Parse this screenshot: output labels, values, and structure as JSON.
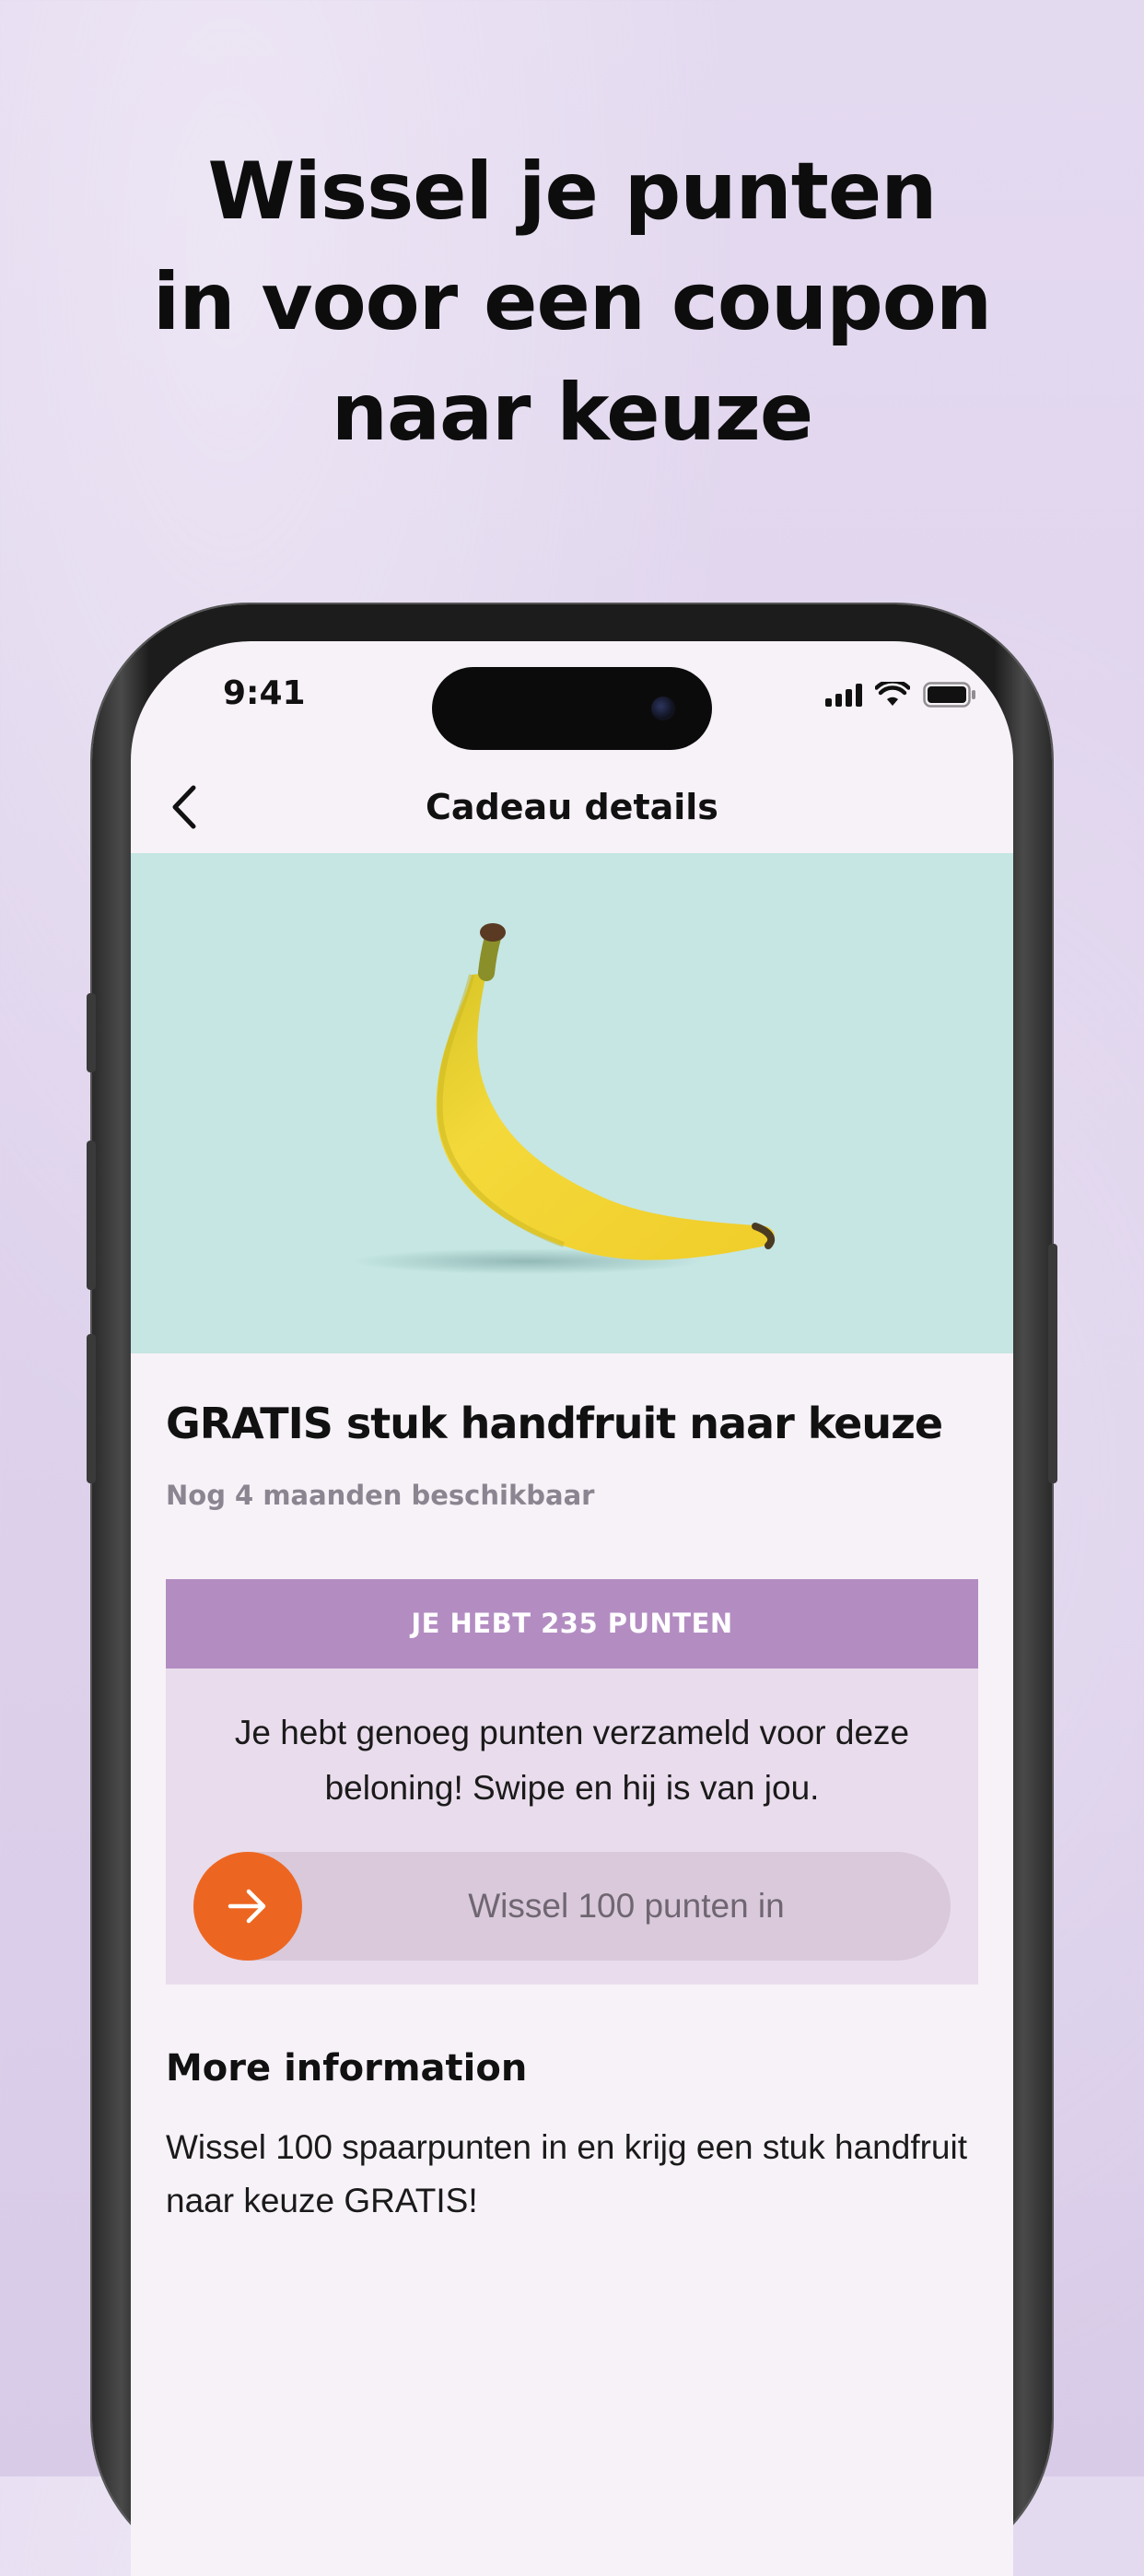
{
  "promo": {
    "headline_line1": "Wissel je punten",
    "headline_line2": "in voor een coupon",
    "headline_line3": "naar keuze"
  },
  "status_bar": {
    "time": "9:41"
  },
  "nav": {
    "title": "Cadeau details",
    "back_icon": "chevron-left-icon"
  },
  "product": {
    "image": "banana",
    "title": "GRATIS stuk handfruit naar keuze",
    "availability": "Nog 4 maanden beschikbaar"
  },
  "points": {
    "header": "JE HEBT 235 PUNTEN",
    "message": "Je hebt genoeg punten verzameld voor deze beloning! Swipe en hij is van jou.",
    "swipe_label": "Wissel 100 punten in",
    "swipe_icon": "arrow-right-icon"
  },
  "more_info": {
    "title": "More information",
    "body": "Wissel 100 spaarpunten in en krijg een stuk handfruit naar keuze GRATIS!"
  },
  "colors": {
    "background": "#e1d6ee",
    "hero_background": "#c5e6e3",
    "points_header": "#b38dc2",
    "points_card": "#e9dcec",
    "swipe_track": "#d9c9da",
    "accent_orange": "#ed6621",
    "screen": "#f7f2f8"
  }
}
